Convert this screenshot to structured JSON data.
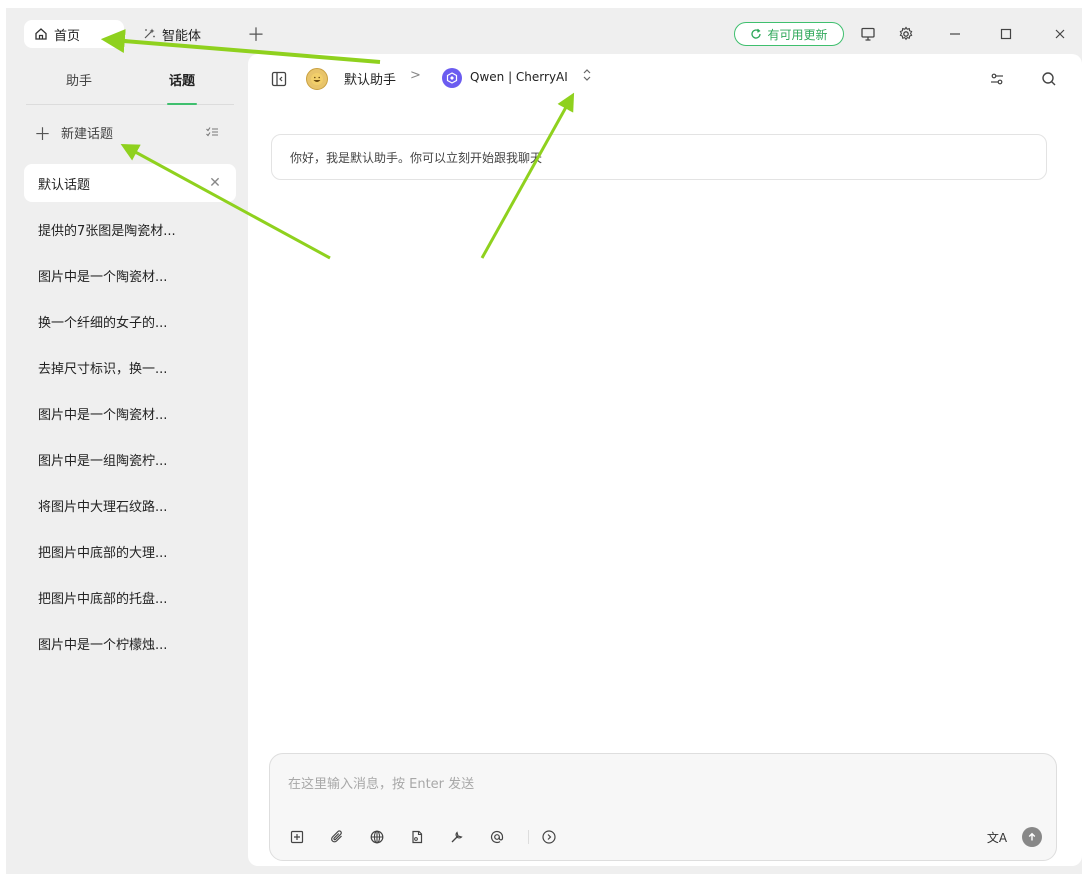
{
  "titlebar": {
    "tabs": [
      {
        "label": "首页",
        "icon": "home-icon"
      },
      {
        "label": "智能体",
        "icon": "sparkle-icon"
      }
    ],
    "add_tab_icon": "plus-icon",
    "update_label": "有可用更新",
    "controls": [
      "monitor-icon",
      "settings-icon",
      "minimize-icon",
      "maximize-icon",
      "close-icon"
    ]
  },
  "sidebar": {
    "tabs": [
      "助手",
      "话题"
    ],
    "active_tab": "话题",
    "new_topic_label": "新建话题",
    "topics": [
      "默认话题",
      "提供的7张图是陶瓷材...",
      "图片中是一个陶瓷材...",
      "换一个纤细的女子的...",
      "去掉尺寸标识，换一...",
      "图片中是一个陶瓷材...",
      "图片中是一组陶瓷柠...",
      "将图片中大理石纹路...",
      "把图片中底部的大理...",
      "把图片中底部的托盘...",
      "图片中是一个柠檬烛..."
    ]
  },
  "main": {
    "assistant_name": "默认助手",
    "crumb_separator": ">",
    "model_name": "Qwen | CherryAI",
    "greeting": "你好，我是默认助手。你可以立刻开始跟我聊天",
    "composer_placeholder": "在这里输入消息，按 Enter 发送",
    "composer_tools": [
      "add-context-icon",
      "attachment-icon",
      "web-search-icon",
      "knowledge-icon",
      "tools-icon",
      "mention-icon",
      "expand-icon"
    ],
    "translate_label": "文A"
  },
  "colors": {
    "accent": "#3fbf6e",
    "arrow": "#8fd11e",
    "panel_bg": "#efefef"
  }
}
